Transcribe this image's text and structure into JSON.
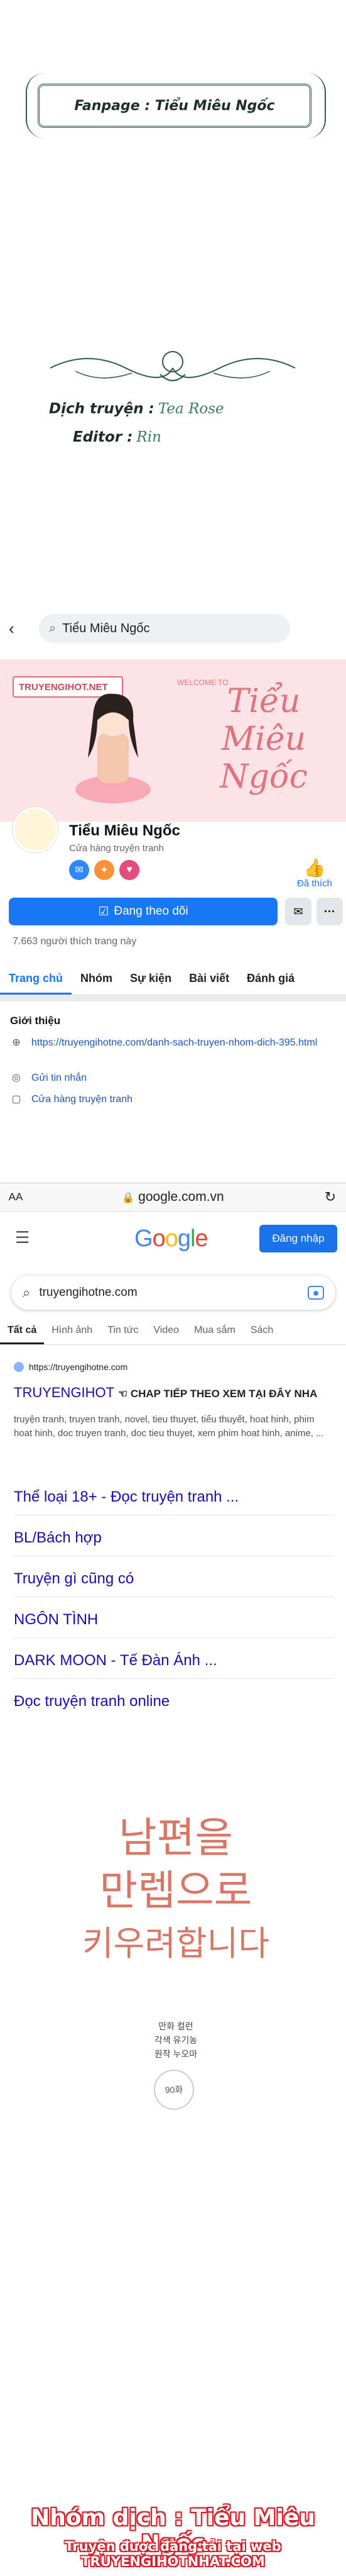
{
  "credits": {
    "fanpage": "Fanpage : Tiểu Miêu Ngốc",
    "translator_label": "Dịch truyện :",
    "translator_sig": "Tea Rose",
    "editor_label": "Editor :",
    "editor_sig": "Rin"
  },
  "facebook": {
    "search_text": "Tiểu Miêu Ngốc",
    "cover_logo": "TRUYENGIHOT.NET",
    "cover_welcome": "WELCOME TO",
    "cover_title": "Tiểu Miêu Ngốc",
    "page_name": "Tiểu Miêu Ngốc",
    "category": "Cửa hàng truyện tranh",
    "like_label": "Đã thích",
    "follow_label": "Đang theo dõi",
    "likes_count": "7.663 người thích trang này",
    "tabs": [
      "Trang chủ",
      "Nhóm",
      "Sự kiện",
      "Bài viết",
      "Đánh giá"
    ],
    "intro_title": "Giới thiệu",
    "intro_rows": [
      {
        "icon": "link-icon",
        "text": "https://truyengihotne.com/danh-sach-truyen-nhom-dich-395.html"
      },
      {
        "icon": "messenger-icon",
        "text": "Gửi tin nhắn"
      },
      {
        "icon": "shop-icon",
        "text": "Cửa hàng truyện tranh"
      }
    ]
  },
  "browser": {
    "aa": "AA",
    "url": "google.com.vn",
    "login": "Đăng nhập",
    "query": "truyengihotne.com",
    "tabs": [
      "Tất cả",
      "Hình ảnh",
      "Tin tức",
      "Video",
      "Mua sắm",
      "Sách"
    ],
    "result_site": "https://truyengihotne.com",
    "result_title": "TRUYENGIHOT",
    "result_highlight": "CHAP TIẾP THEO XEM TẠI ĐÂY NHA",
    "result_snippet": "truyện tranh, truyen tranh, novel, tieu thuyet, tiểu thuyết, hoat hinh, phim hoat hinh, doc truyen tranh, doc tieu thuyet, xem phim hoat hinh, anime, ...",
    "links": [
      "Thể loại 18+ - Đọc truyện tranh ...",
      "BL/Bách hợp",
      "Truyện gì cũng có",
      "NGÔN TÌNH",
      "DARK MOON - Tế Đàn Ánh ...",
      "Đọc truyện tranh online"
    ]
  },
  "manhwa": {
    "title_line1": "남편을",
    "title_line2": "만렙으로",
    "title_line3": "키우려합니다",
    "credit1": "만화 컬런",
    "credit2": "각색 유기농",
    "credit3": "원작 누오마",
    "episode": "90화"
  },
  "footer": {
    "group": "Nhóm dịch : Tiểu Miêu Ngốc",
    "note": "Truyện được đăng tải tại web TRUYENGIHOTNHAT.COM"
  }
}
